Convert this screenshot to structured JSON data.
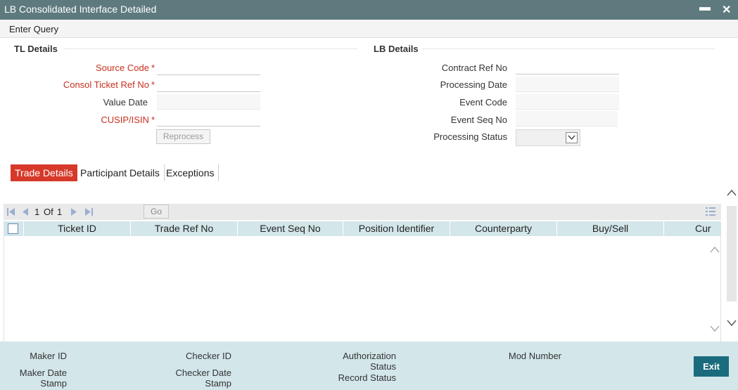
{
  "window": {
    "title": "LB Consolidated Interface Detailed",
    "minimize_glyph": "▬",
    "close_glyph": "✕"
  },
  "menu": {
    "enter_query": "Enter Query"
  },
  "tl_details": {
    "title": "TL Details",
    "source_code_label": "Source Code",
    "consol_ticket_label": "Consol Ticket Ref No",
    "value_date_label": "Value Date",
    "cusip_label": "CUSIP/ISIN",
    "required_mark": "*",
    "reprocess_label": "Reprocess",
    "source_code_value": "",
    "consol_ticket_value": "",
    "value_date_value": "",
    "cusip_value": ""
  },
  "lb_details": {
    "title": "LB Details",
    "contract_ref_label": "Contract Ref No",
    "processing_date_label": "Processing Date",
    "event_code_label": "Event Code",
    "event_seq_label": "Event Seq No",
    "processing_status_label": "Processing Status",
    "contract_ref_value": "",
    "processing_date_value": "",
    "event_code_value": "",
    "event_seq_value": "",
    "processing_status_value": ""
  },
  "tabs": [
    {
      "label": "Trade Details",
      "active": true
    },
    {
      "label": "Participant Details",
      "active": false
    },
    {
      "label": "Exceptions",
      "active": false
    }
  ],
  "pager": {
    "current": "1",
    "of_label": "Of",
    "total": "1",
    "go_label": "Go"
  },
  "grid": {
    "columns": [
      "Ticket ID",
      "Trade Ref No",
      "Event Seq No",
      "Position Identifier",
      "Counterparty",
      "Buy/Sell",
      "Cur"
    ],
    "rows": []
  },
  "footer": {
    "maker_id": "Maker ID",
    "maker_date_1": "Maker Date",
    "maker_date_2": "Stamp",
    "checker_id": "Checker ID",
    "checker_date_1": "Checker Date",
    "checker_date_2": "Stamp",
    "auth_status_1": "Authorization",
    "auth_status_2": "Status",
    "record_status": "Record Status",
    "mod_number": "Mod Number",
    "exit_label": "Exit"
  },
  "colors": {
    "titlebar": "#5e7a7f",
    "active_tab": "#d6392a",
    "required": "#c9301f",
    "grid_header": "#d3e6ea",
    "exit_button": "#1a6b7d"
  }
}
